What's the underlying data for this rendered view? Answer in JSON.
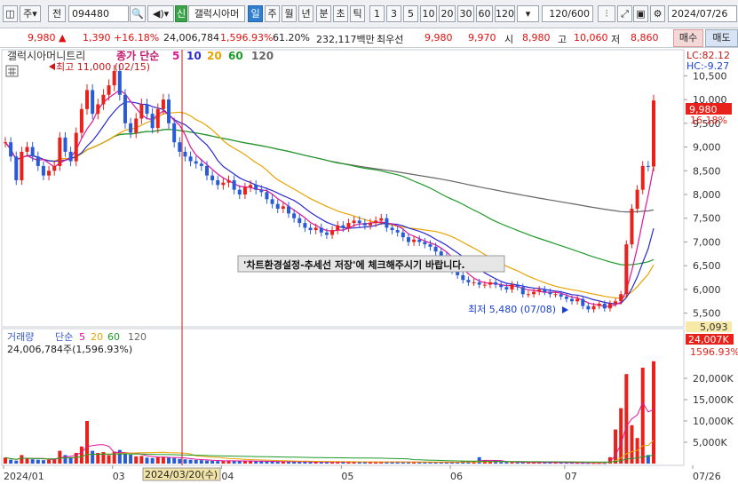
{
  "toolbar": {
    "market_label": "주",
    "prev_label": "전",
    "code": "094480",
    "new_label": "신",
    "stock_name": "갤럭시아머",
    "periods": [
      "일",
      "주",
      "월",
      "년",
      "분",
      "초",
      "틱"
    ],
    "intervals": [
      "1",
      "3",
      "5",
      "10",
      "20",
      "30",
      "60",
      "120"
    ],
    "count": "120/600",
    "date": "2024/07/26"
  },
  "info": {
    "price": "9,980",
    "arrow": "▲",
    "change": "1,390",
    "change_pct": "+16.18%",
    "volume": "24,006,784",
    "volume_pct": "1,596.93%",
    "ratio": "61.20%",
    "amount": "232,117백만",
    "best_label": "최우선",
    "best_ask": "9,980",
    "best_bid": "9,970",
    "open_label": "시",
    "open": "8,980",
    "high_label": "고",
    "high": "10,060",
    "low_label": "저",
    "low": "8,860",
    "buy_label": "매수",
    "sell_label": "매도"
  },
  "chart": {
    "stock_label": "갤럭시아머니트리",
    "ma_label": "종가 단순",
    "ma_periods": [
      "5",
      "10",
      "20",
      "60",
      "120"
    ],
    "max_note": "최고 11,000 (02/15)",
    "min_note": "최저 5,480 (07/08)",
    "notice": "'차트환경설정-추세선 저장'에 체크해주시기 바랍니다.",
    "lc": "LC:82.12",
    "hc": "HC:-9.27",
    "price_tag": "9,980",
    "pct_tag": "16.18%",
    "vol_label": "거래량",
    "vol_ma_label": "단순",
    "vol_ma_periods": [
      "5",
      "20",
      "60",
      "120"
    ],
    "vol_value_text": "24,006,784주(1,596.93%)",
    "vol_tag1": "5,093",
    "vol_tag2": "24,007K",
    "vol_tag3": "1596.93%",
    "crosshair_date": "2024/03/20(수)",
    "colors": {
      "up": "#e8221a",
      "down": "#2a5bd7",
      "ma5": "#e0139a",
      "ma10": "#2a2ad0",
      "ma20": "#e8a300",
      "ma60": "#1f9a2a",
      "ma120": "#666666"
    }
  },
  "chart_data": {
    "type": "candlestick",
    "x_ticks": [
      "2024/01",
      "03",
      "04",
      "05",
      "06",
      "07",
      "07/26"
    ],
    "y_ticks": [
      "10,500",
      "10,000",
      "9,500",
      "9,000",
      "8,500",
      "8,000",
      "7,500",
      "7,000",
      "6,500",
      "6,000",
      "5,500"
    ],
    "vol_ticks": [
      "20,000K",
      "15,000K",
      "10,000K",
      "5,000K"
    ],
    "ylim": [
      5250,
      10900
    ],
    "vol_ylim": [
      0,
      25000
    ],
    "close": [
      9100,
      8800,
      8300,
      8900,
      9000,
      8800,
      8600,
      8400,
      8500,
      8600,
      9200,
      8900,
      8700,
      9300,
      9800,
      10200,
      9700,
      9900,
      10100,
      10300,
      10600,
      10100,
      9500,
      9300,
      9600,
      9900,
      9700,
      9400,
      9800,
      10000,
      9500,
      9100,
      8900,
      8800,
      8700,
      8650,
      8600,
      8400,
      8300,
      8200,
      8250,
      8300,
      8100,
      8000,
      8150,
      8200,
      8100,
      8050,
      7900,
      7800,
      7700,
      7750,
      7600,
      7500,
      7400,
      7300,
      7250,
      7300,
      7200,
      7150,
      7250,
      7350,
      7300,
      7400,
      7450,
      7400,
      7350,
      7400,
      7450,
      7500,
      7300,
      7250,
      7200,
      7100,
      7000,
      7050,
      7000,
      6950,
      6900,
      6800,
      6700,
      6600,
      6400,
      6300,
      6200,
      6150,
      6150,
      6100,
      6100,
      6150,
      6100,
      6050,
      6000,
      6100,
      6050,
      5900,
      5900,
      5950,
      6000,
      5950,
      5900,
      5900,
      5850,
      5800,
      5750,
      5800,
      5650,
      5580,
      5650,
      5700,
      5600,
      5700,
      5750,
      5900,
      6950,
      7700,
      8100,
      8600,
      8590,
      9980
    ],
    "volume": [
      1400,
      900,
      700,
      2000,
      1300,
      1000,
      900,
      800,
      900,
      1100,
      3000,
      2000,
      1500,
      2500,
      4000,
      10000,
      3000,
      2500,
      2700,
      2000,
      2800,
      3200,
      2200,
      2100,
      1700,
      1800,
      1400,
      1300,
      1500,
      1600,
      1500,
      1300,
      1100,
      1000,
      900,
      850,
      800,
      700,
      650,
      600,
      600,
      700,
      650,
      600,
      580,
      560,
      550,
      520,
      500,
      480,
      470,
      460,
      450,
      430,
      420,
      400,
      390,
      380,
      380,
      370,
      380,
      400,
      380,
      390,
      400,
      380,
      370,
      380,
      390,
      400,
      380,
      370,
      360,
      350,
      340,
      330,
      320,
      310,
      300,
      300,
      290,
      280,
      280,
      270,
      600,
      500,
      400,
      1500,
      800,
      500,
      400,
      350,
      320,
      300,
      290,
      280,
      270,
      260,
      250,
      240,
      230,
      220,
      210,
      200,
      190,
      180,
      170,
      160,
      150,
      140,
      140,
      1500,
      8000,
      13000,
      21000,
      9000,
      6000,
      22500,
      2000,
      24007
    ]
  }
}
